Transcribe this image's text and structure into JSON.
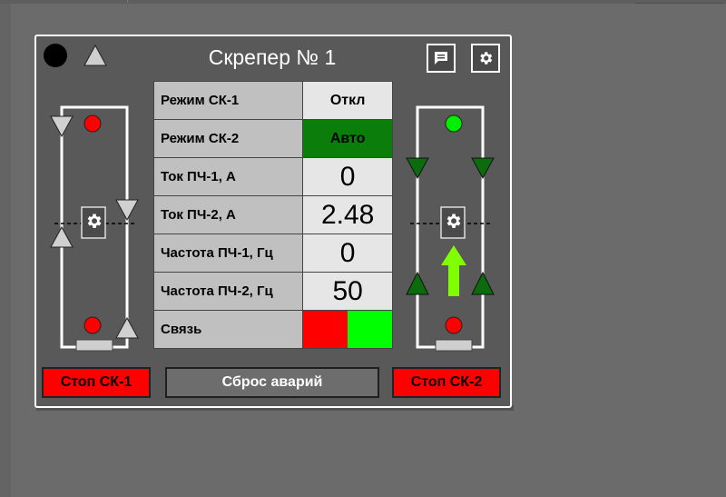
{
  "panel": {
    "title": "Скрепер № 1",
    "status_color": "#000000"
  },
  "params": [
    {
      "label": "Режим СК-1",
      "value": "Откл"
    },
    {
      "label": "Режим СК-2",
      "value": "Авто"
    },
    {
      "label": "Ток ПЧ-1, А",
      "value": "0"
    },
    {
      "label": "Ток ПЧ-2, А",
      "value": "2.48"
    },
    {
      "label": "Частота ПЧ-1, Гц",
      "value": "0"
    },
    {
      "label": "Частота ПЧ-2, Гц",
      "value": "50"
    },
    {
      "label": "Связь",
      "value_colors": [
        "#ff0000",
        "#00ff00"
      ]
    }
  ],
  "buttons": {
    "stop1": "Стоп СК-1",
    "reset": "Сброс аварий",
    "stop2": "Стоп СК-2"
  },
  "icons": {
    "messages": "message-icon",
    "settings": "gear-icon"
  },
  "colors": {
    "alarm_red": "#ff0000",
    "ok_green": "#00ee00",
    "auto_green": "#0a7d0a",
    "arrow_green": "#7fff00",
    "triangle_green": "#0c6b0c",
    "triangle_gray": "#d0d0d0"
  },
  "sk1": {
    "top_lamp": "red",
    "bottom_lamp": "red",
    "direction": "none"
  },
  "sk2": {
    "top_lamp": "green",
    "bottom_lamp": "red",
    "direction": "up"
  }
}
